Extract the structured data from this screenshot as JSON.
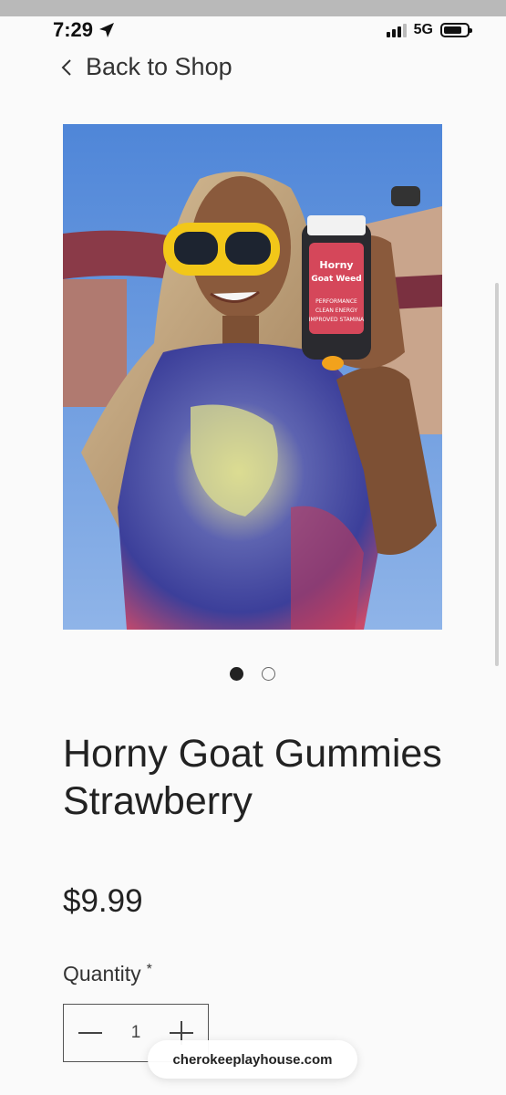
{
  "status_bar": {
    "time": "7:29",
    "network": "5G",
    "battery_level": 0.8
  },
  "nav": {
    "back_label": "Back to Shop"
  },
  "gallery": {
    "image_alt": "Woman in yellow sunglasses holding Horny Goat Gummies bottle",
    "total_images": 2,
    "active_index": 0,
    "bottle_label_lines": [
      "Horny",
      "Goat Weed",
      "PERFORMANCE",
      "CLEAN ENERGY",
      "IMPROVED STAMINA"
    ]
  },
  "product": {
    "title": "Horny Goat Gummies Strawberry",
    "price": "$9.99",
    "quantity_label": "Quantity",
    "required_marker": "*",
    "quantity_value": "1"
  },
  "browser": {
    "url": "cherokeeplayhouse.com"
  },
  "colors": {
    "background": "#fafafa",
    "text": "#222222",
    "sky": "#5f8fd8",
    "sunglasses": "#f2c719"
  }
}
